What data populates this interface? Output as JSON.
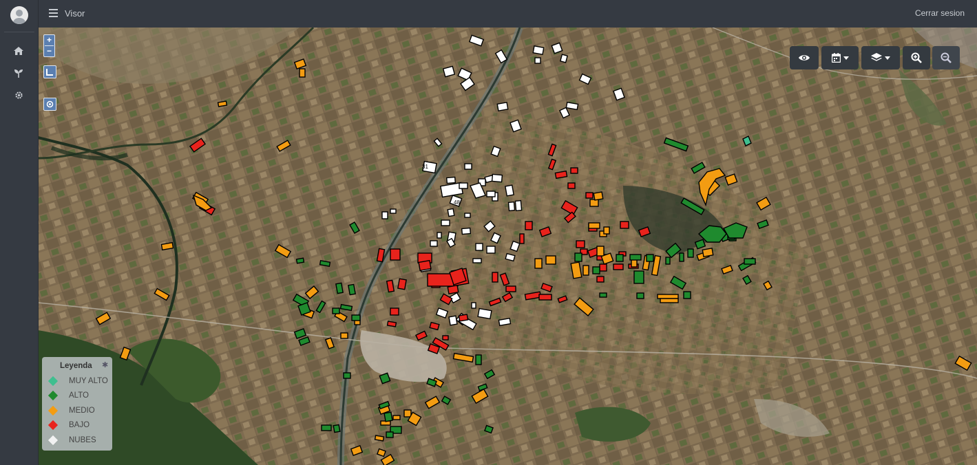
{
  "app": {
    "title": "Visor",
    "logout_label": "Cerrar sesion"
  },
  "sidebar": {
    "items": [
      {
        "icon": "home-icon"
      },
      {
        "icon": "seedling-icon"
      },
      {
        "icon": "gear-icon"
      }
    ]
  },
  "map": {
    "zoom_in_label": "+",
    "zoom_out_label": "−",
    "parcel_labels": [
      "31",
      "48"
    ],
    "toolbar": [
      {
        "icon": "eye-icon"
      },
      {
        "icon": "calendar-icon"
      },
      {
        "icon": "layers-icon"
      },
      {
        "icon": "zoom-in-icon"
      },
      {
        "icon": "zoom-out-icon"
      }
    ]
  },
  "legend": {
    "title": "Leyenda",
    "items": [
      {
        "label": "MUY ALTO",
        "color": "#3fbf8f"
      },
      {
        "label": "ALTO",
        "color": "#1f8a2e"
      },
      {
        "label": "MEDIO",
        "color": "#f39c12"
      },
      {
        "label": "BAJO",
        "color": "#e8231c"
      },
      {
        "label": "NUBES",
        "color": "#f2f2f2"
      }
    ]
  },
  "colors": {
    "topbar": "#353a42",
    "muy_alto": "#3fbf8f",
    "alto": "#1f8a2e",
    "medio": "#f39c12",
    "bajo": "#e8231c",
    "nubes": "#ffffff"
  }
}
